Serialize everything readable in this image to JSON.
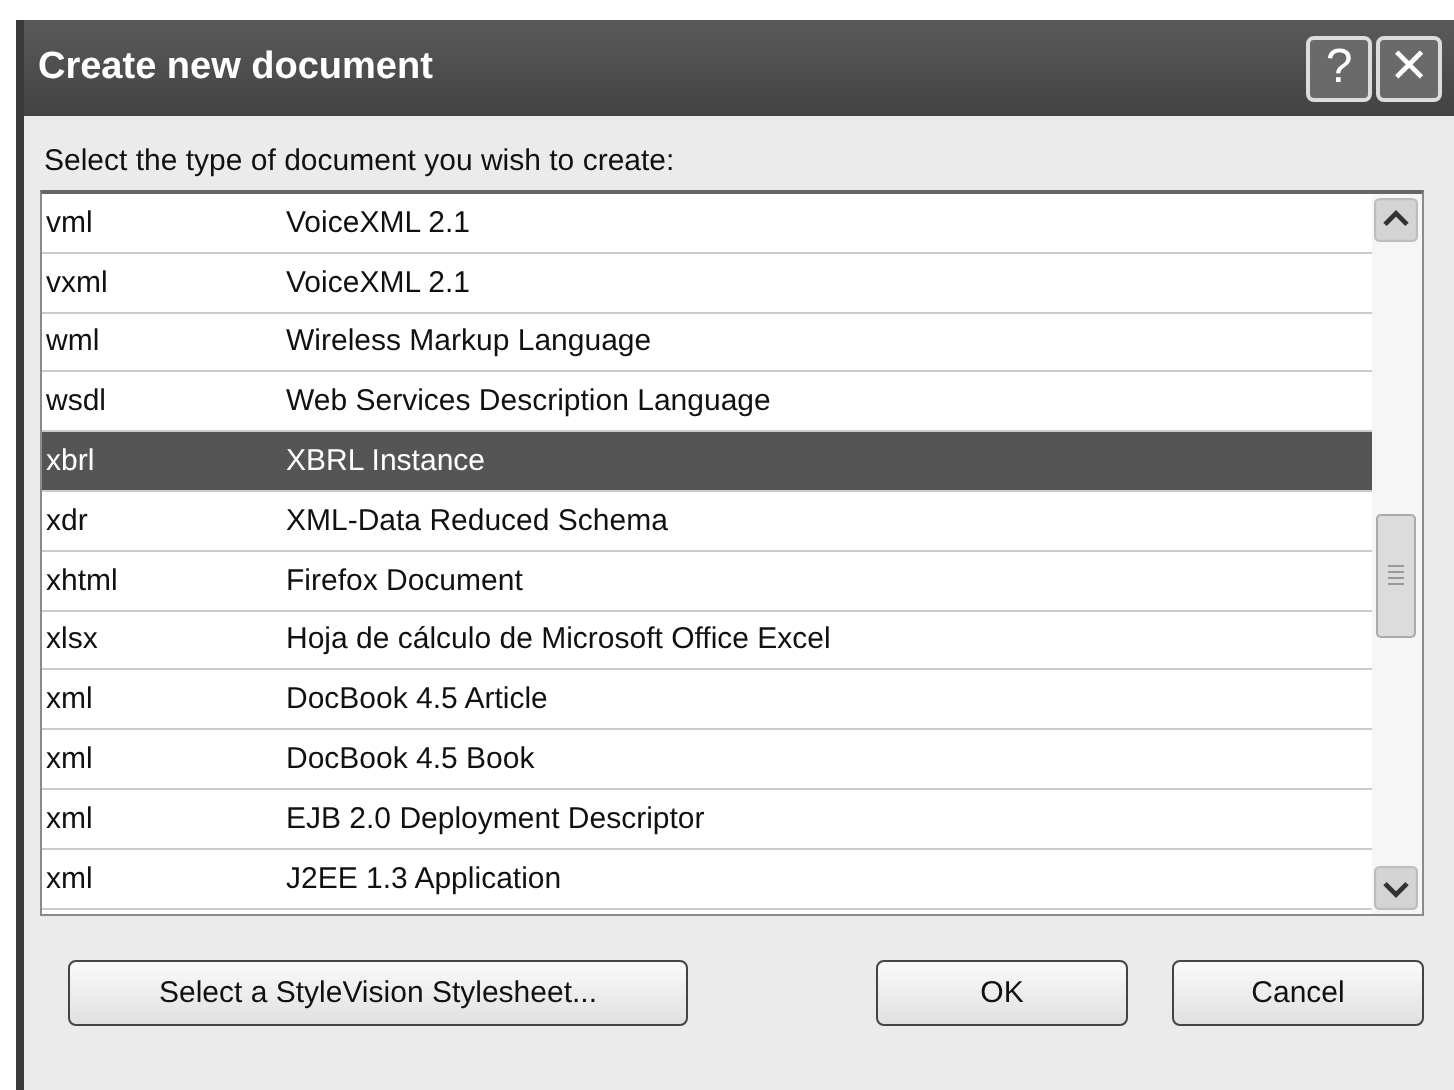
{
  "window": {
    "title": "Create new document",
    "help_button": "?",
    "close_button": "✕"
  },
  "prompt": "Select the type of document you wish to create:",
  "list": {
    "rows": [
      {
        "extension": "vml",
        "description": "VoiceXML 2.1",
        "selected": false
      },
      {
        "extension": "vxml",
        "description": "VoiceXML 2.1",
        "selected": false
      },
      {
        "extension": "wml",
        "description": "Wireless Markup Language",
        "selected": false
      },
      {
        "extension": "wsdl",
        "description": "Web Services Description Language",
        "selected": false
      },
      {
        "extension": "xbrl",
        "description": "XBRL Instance",
        "selected": true
      },
      {
        "extension": "xdr",
        "description": "XML-Data Reduced Schema",
        "selected": false
      },
      {
        "extension": "xhtml",
        "description": "Firefox Document",
        "selected": false
      },
      {
        "extension": "xlsx",
        "description": "Hoja de cálculo de Microsoft Office Excel",
        "selected": false
      },
      {
        "extension": "xml",
        "description": "DocBook 4.5 Article",
        "selected": false
      },
      {
        "extension": "xml",
        "description": "DocBook 4.5 Book",
        "selected": false
      },
      {
        "extension": "xml",
        "description": "EJB 2.0 Deployment Descriptor",
        "selected": false
      },
      {
        "extension": "xml",
        "description": "J2EE 1.3 Application",
        "selected": false
      }
    ]
  },
  "buttons": [
    "Select a StyleVision Stylesheet...",
    "OK",
    "Cancel"
  ]
}
